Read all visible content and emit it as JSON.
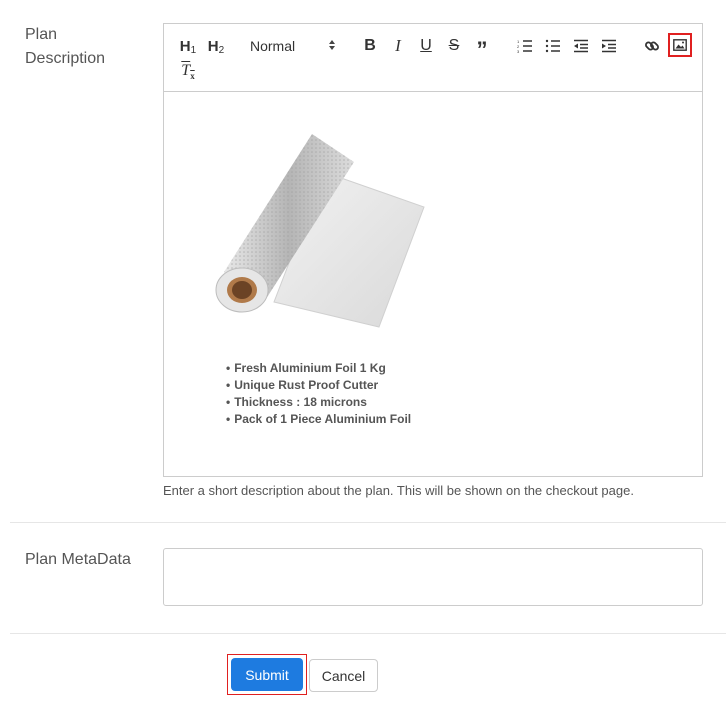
{
  "plan_description": {
    "label_line1": "Plan",
    "label_line2": "Description",
    "toolbar": {
      "h1": "H1",
      "h2": "H2",
      "format_select": "Normal",
      "icons": [
        "bold-icon",
        "italic-icon",
        "underline-icon",
        "strike-icon",
        "blockquote-icon",
        "ordered-list-icon",
        "bullet-list-icon",
        "outdent-icon",
        "indent-icon",
        "link-icon",
        "image-icon",
        "clear-format-icon"
      ]
    },
    "bullets": [
      "Fresh Aluminium Foil 1 Kg",
      "Unique Rust Proof Cutter",
      "Thickness : 18 microns",
      "Pack of 1 Piece Aluminium Foil"
    ],
    "help_text": "Enter a short description about the plan. This will be shown on the checkout page."
  },
  "plan_metadata": {
    "label": "Plan MetaData",
    "value": ""
  },
  "actions": {
    "submit_label": "Submit",
    "cancel_label": "Cancel"
  },
  "colors": {
    "primary": "#1e7be0",
    "highlight": "#e02020",
    "border": "#cccccc"
  }
}
